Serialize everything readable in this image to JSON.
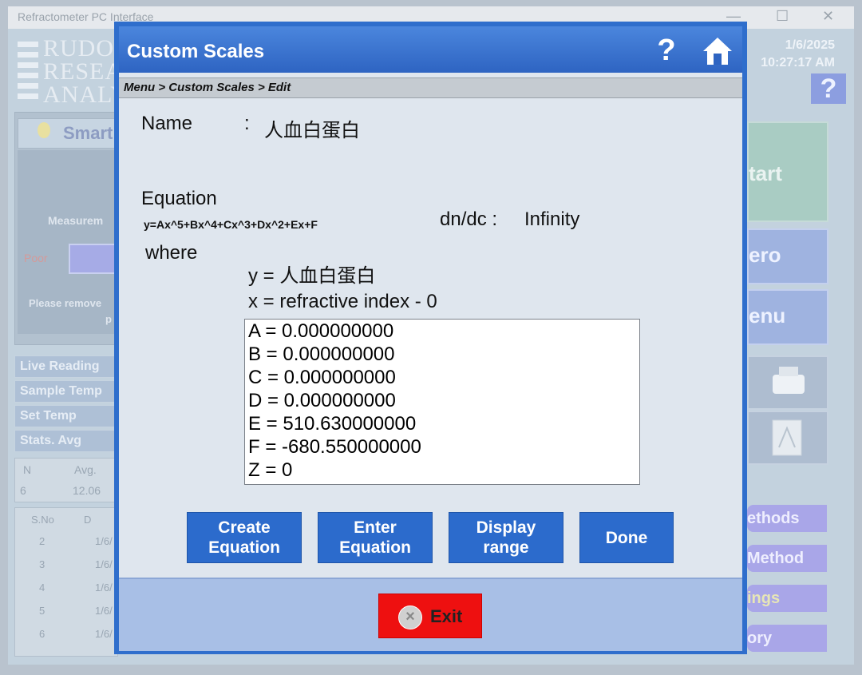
{
  "background": {
    "window_title": "Refractometer PC Interface",
    "logo_lines": [
      "RUDO",
      "RESEA",
      "ANALY"
    ],
    "date": "1/6/2025",
    "time": "10:27:17 AM",
    "help_label": "?",
    "smart_label": "Smart",
    "measurement_label": "Measurem",
    "poor_label": "Poor",
    "remove_line1": "Please remove",
    "remove_line2": "p",
    "reading_rows": [
      "Live Reading",
      "Sample Temp",
      "Set Temp",
      "Stats. Avg"
    ],
    "stats": {
      "headers": [
        "N",
        "Avg."
      ],
      "values": [
        "6",
        "12.06"
      ]
    },
    "table": {
      "headers": [
        "S.No",
        "D"
      ],
      "rows": [
        [
          "2",
          "1/6/"
        ],
        [
          "3",
          "1/6/"
        ],
        [
          "4",
          "1/6/"
        ],
        [
          "5",
          "1/6/"
        ],
        [
          "6",
          "1/6/"
        ]
      ]
    },
    "right_buttons": [
      "tart",
      "ero",
      "enu"
    ],
    "right_pills": [
      "ethods",
      "Method",
      "ings",
      "ory"
    ]
  },
  "dialog": {
    "title": "Custom Scales",
    "help": "?",
    "breadcrumb": "Menu > Custom Scales > Edit",
    "name_label": "Name",
    "colon": ":",
    "name_value": "人血白蛋白",
    "equation_label": "Equation",
    "equation_formula": "y=Ax^5+Bx^4+Cx^3+Dx^2+Ex+F",
    "dndc_label": "dn/dc :",
    "dndc_value": "Infinity",
    "where_label": "where",
    "y_def": "y = 人血白蛋白",
    "x_def": "x = refractive index - 0",
    "coefficients": [
      "A = 0.000000000",
      "B = 0.000000000",
      "C = 0.000000000",
      "D = 0.000000000",
      "E = 510.630000000",
      "F = -680.550000000",
      "Z = 0"
    ],
    "buttons": {
      "create_line1": "Create",
      "create_line2": "Equation",
      "enter_line1": "Enter",
      "enter_line2": "Equation",
      "display_line1": "Display",
      "display_line2": "range",
      "done": "Done"
    },
    "exit_label": "Exit"
  },
  "colors": {
    "dialog_blue": "#2f6ecc",
    "button_blue": "#2c6bcc",
    "exit_red": "#ee1010"
  }
}
